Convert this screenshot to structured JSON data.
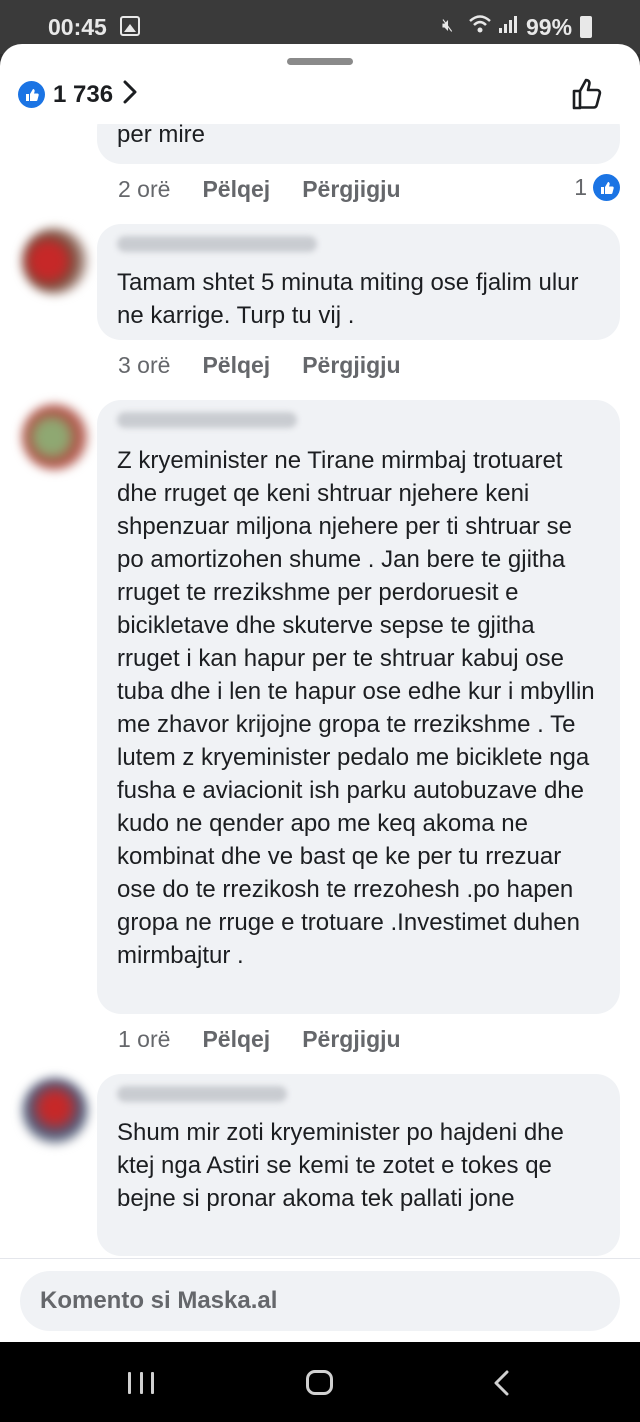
{
  "status_bar": {
    "time": "00:45",
    "battery": "99%",
    "icons": [
      "gallery-icon",
      "mute-icon",
      "wifi-icon",
      "signal-icon",
      "battery-icon"
    ]
  },
  "reactions": {
    "count": "1 736",
    "icons": [
      "like-badge-icon",
      "chevron-right-icon",
      "thumbs-up-icon"
    ]
  },
  "comments": [
    {
      "text": "per mire",
      "age": "2 orë",
      "like": "Pëlqej",
      "reply": "Përgjigju",
      "reaction_count": "1"
    },
    {
      "text": "Tamam shtet 5 minuta miting ose fjalim ulur ne karrige. Turp tu vij .",
      "age": "3 orë",
      "like": "Pëlqej",
      "reply": "Përgjigju"
    },
    {
      "text": "Z kryeminister ne Tirane mirmbaj trotuaret dhe rruget qe keni shtruar njehere keni shpenzuar miljona njehere per ti shtruar se po amortizohen shume . Jan bere te gjitha rruget te rrezikshme per perdoruesit e bicikletave dhe skuterve sepse te gjitha rruget i kan hapur per te shtruar kabuj ose tuba dhe i len te hapur ose edhe kur i mbyllin me zhavor krijojne gropa te rrezikshme . Te lutem z kryeminister pedalo me biciklete nga fusha e aviacionit ish parku autobuzave dhe kudo ne qender apo me keq akoma ne kombinat dhe ve bast qe ke per tu rrezuar ose do te rrezikosh te rrezohesh .po hapen gropa ne rruge e trotuare .Investimet duhen mirmbajtur .",
      "age": "1 orë",
      "like": "Pëlqej",
      "reply": "Përgjigju"
    },
    {
      "text": "Shum mir zoti kryeminister po hajdeni dhe ktej nga Astiri se kemi te zotet e tokes qe bejne si pronar akoma tek pallati jone"
    }
  ],
  "comment_input": {
    "placeholder": "Komento si Maska.al"
  },
  "nav_bar": {
    "icons": [
      "recents-icon",
      "home-icon",
      "back-icon"
    ]
  },
  "colors": {
    "accent": "#1b74e4",
    "bubble": "#f0f2f5",
    "text": "#1c1e21",
    "muted": "#65676b"
  }
}
